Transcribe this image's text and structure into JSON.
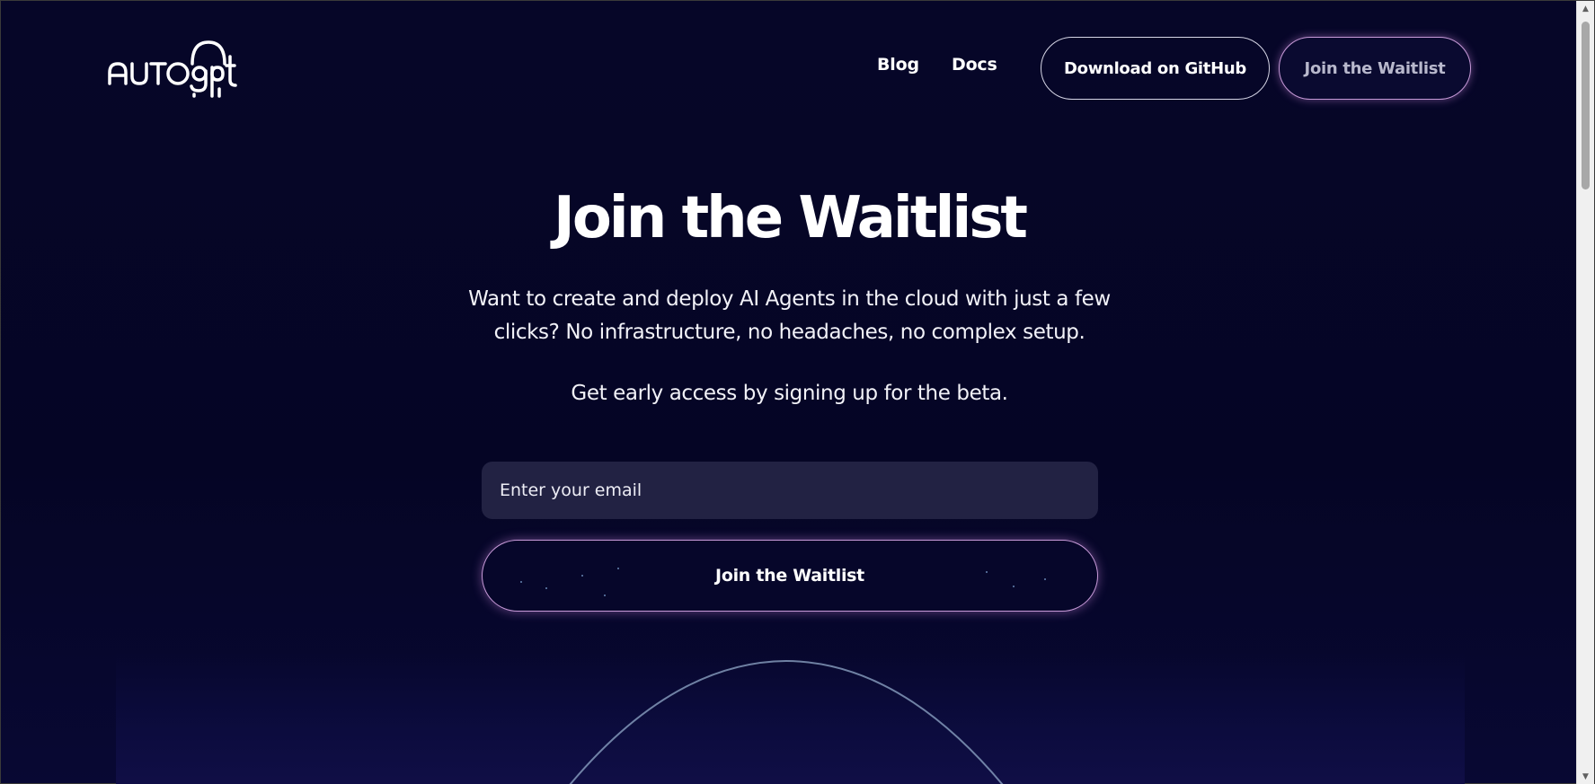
{
  "header": {
    "logo_text": "AUTOgpt",
    "nav": [
      {
        "label": "Blog"
      },
      {
        "label": "Docs"
      }
    ],
    "github_button": "Download on GitHub",
    "waitlist_button": "Join the Waitlist"
  },
  "hero": {
    "title": "Join the Waitlist",
    "description": "Want to create and deploy AI Agents in the cloud with just a few clicks? No infrastructure, no headaches, no complex setup.",
    "subtitle": "Get early access by signing up for the beta.",
    "email_placeholder": "Enter your email",
    "submit_button": "Join the Waitlist"
  },
  "colors": {
    "background": "#06062a",
    "glow_border": "#c79ad8",
    "input_bg": "#222243"
  }
}
